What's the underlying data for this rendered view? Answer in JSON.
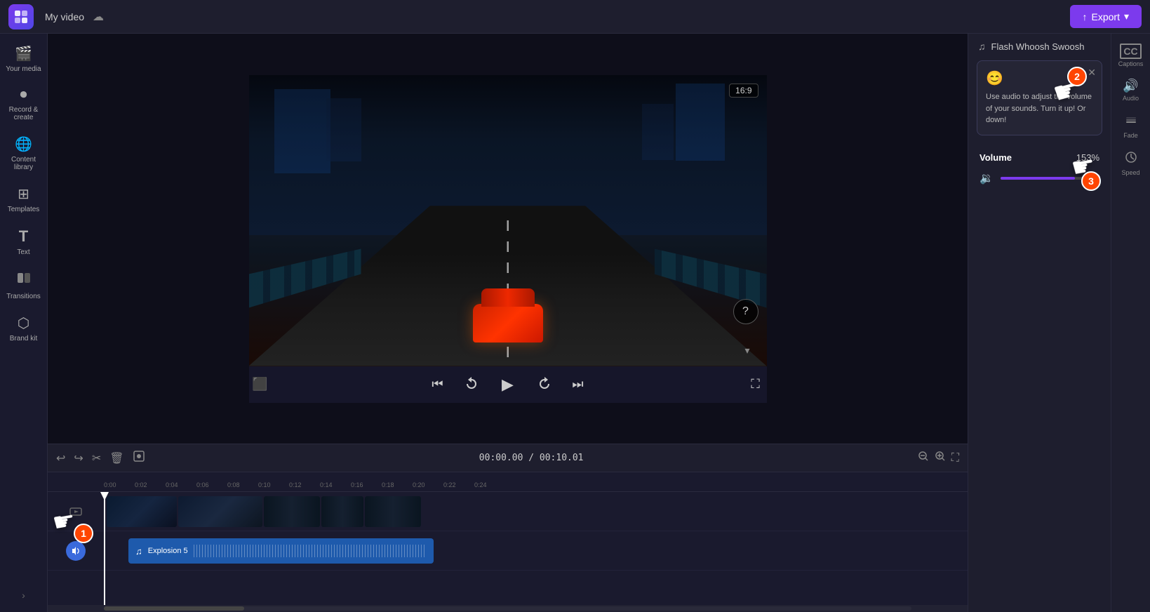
{
  "header": {
    "project_name": "My video",
    "export_label": "Export",
    "export_icon": "↑"
  },
  "sidebar": {
    "items": [
      {
        "id": "your-media",
        "label": "Your media",
        "icon": "🎬"
      },
      {
        "id": "record",
        "label": "Record & create",
        "icon": "⏺"
      },
      {
        "id": "content-library",
        "label": "Content library",
        "icon": "🌐"
      },
      {
        "id": "templates",
        "label": "Templates",
        "icon": "⊞"
      },
      {
        "id": "text",
        "label": "Text",
        "icon": "T"
      },
      {
        "id": "transitions",
        "label": "Transitions",
        "icon": "⬜"
      },
      {
        "id": "brand-kit",
        "label": "Brand kit",
        "icon": "⬡"
      }
    ]
  },
  "video_preview": {
    "aspect_ratio": "16:9",
    "time_current": "00:00.00",
    "time_total": "00:10.01",
    "help_icon": "?"
  },
  "playback": {
    "skip_start": "⏮",
    "rewind": "↺",
    "play": "▶",
    "fast_forward": "↻",
    "skip_end": "⏭",
    "subtitle": "⬜",
    "fullscreen": "⛶"
  },
  "timeline": {
    "toolbar": {
      "undo": "↩",
      "redo": "↪",
      "cut": "✂",
      "delete": "🗑",
      "save": "💾",
      "zoom_out": "🔍",
      "zoom_in": "🔍",
      "fullscreen": "⛶"
    },
    "time_display": "00:00.00 / 00:10.01",
    "ruler_marks": [
      "0:00",
      "0:02",
      "0:04",
      "0:06",
      "0:08",
      "0:10",
      "0:12",
      "0:14",
      "0:16",
      "0:18",
      "0:20",
      "0:22",
      "0:24"
    ],
    "tracks": {
      "video_label": "",
      "audio_label": ""
    },
    "audio_track_name": "Explosion 5"
  },
  "right_panel": {
    "tooltip": {
      "emoji": "😊",
      "text": "Use audio to adjust the volume of your sounds. Turn it up! Or down!"
    },
    "volume": {
      "label": "Volume",
      "percent": "153%",
      "fill_width": "75%"
    },
    "music_title": "Flash Whoosh Swoosh",
    "rail_items": [
      {
        "id": "captions",
        "label": "Captions",
        "icon": "CC"
      },
      {
        "id": "audio",
        "label": "Audio",
        "icon": "🔊"
      },
      {
        "id": "fade",
        "label": "Fade",
        "icon": "≋"
      },
      {
        "id": "speed",
        "label": "Speed",
        "icon": "⏱"
      }
    ]
  },
  "annotations": {
    "step1": "1",
    "step2": "2",
    "step3": "3"
  }
}
